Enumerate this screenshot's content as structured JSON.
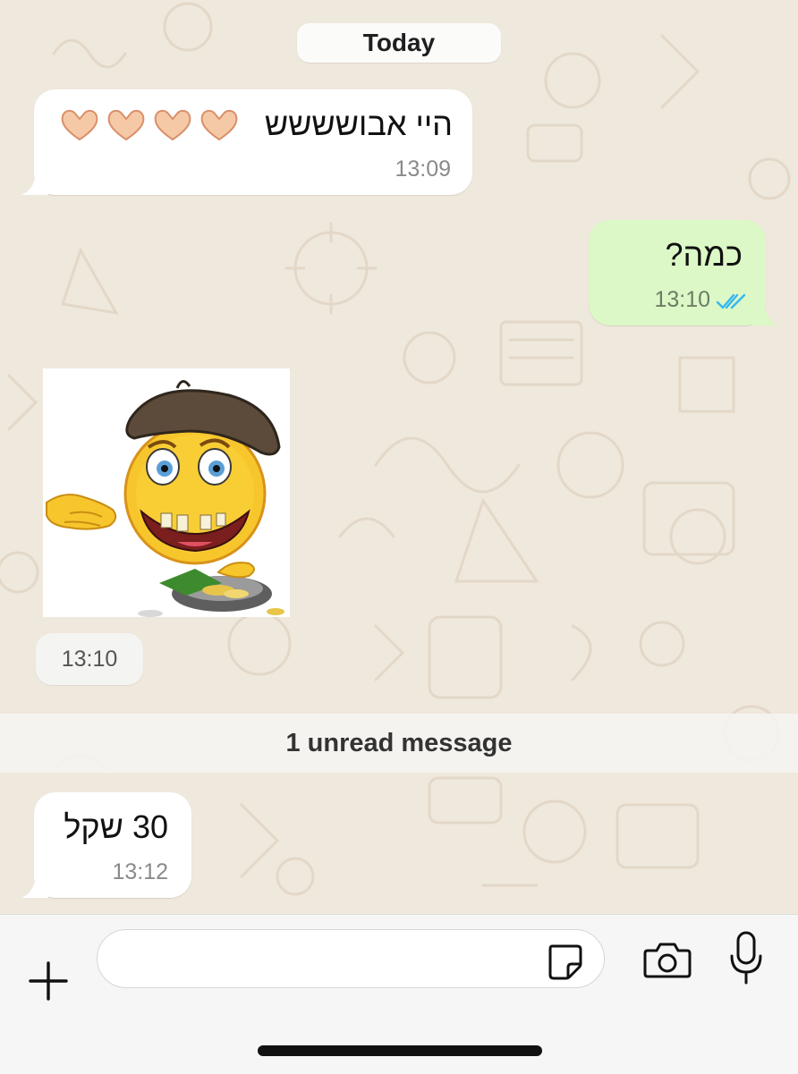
{
  "date_label": "Today",
  "messages": [
    {
      "text": "היי אבושששש",
      "emoji": "🫶🏼🫶🏼🫶🏼🫶🏼",
      "time": "13:09",
      "direction": "incoming"
    },
    {
      "text": "כמה?",
      "time": "13:10",
      "direction": "outgoing",
      "status": "read"
    },
    {
      "type": "sticker",
      "time": "13:10",
      "direction": "incoming"
    },
    {
      "text": "30 שקל",
      "time": "13:12",
      "direction": "incoming"
    }
  ],
  "unread_label": "1 unread message",
  "composer": {
    "placeholder": "",
    "value": ""
  },
  "icons": [
    "plus-icon",
    "sticker-icon",
    "camera-icon",
    "microphone-icon",
    "double-check-icon"
  ],
  "colors": {
    "outgoing_bubble": "#dcf8c6",
    "incoming_bubble": "#ffffff",
    "read_ticks": "#34b7f1",
    "background": "#efe8dc"
  }
}
